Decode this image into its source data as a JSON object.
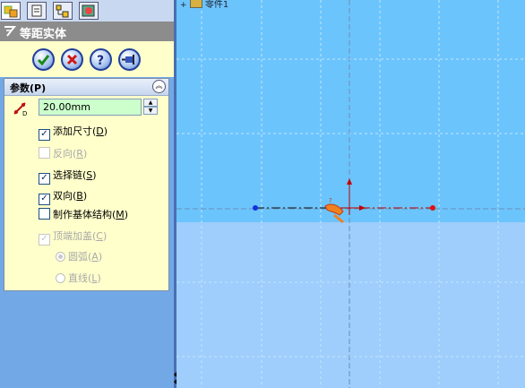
{
  "tree": {
    "item_label": "零件1"
  },
  "panel": {
    "title": "等距实体",
    "group_title": "参数(P)",
    "dimension": {
      "value": "20.00mm"
    },
    "options": [
      {
        "label": "添加尺寸(D)",
        "checked": true,
        "enabled": true
      },
      {
        "label": "反向(R)",
        "checked": false,
        "enabled": false
      },
      {
        "label": "选择链(S)",
        "checked": true,
        "enabled": true
      },
      {
        "label": "双向(B)",
        "checked": true,
        "enabled": true
      },
      {
        "label": "制作基体结构(M)",
        "checked": false,
        "enabled": true
      },
      {
        "label": "顶端加盖(C)",
        "checked": true,
        "enabled": false
      }
    ],
    "cap_options": [
      {
        "label": "圆弧(A)",
        "selected": true
      },
      {
        "label": "直线(L)",
        "selected": false
      }
    ]
  },
  "colors": {
    "background": "#6cc4fc",
    "lower": "#9fcdfc",
    "panel": "#ffffcc",
    "sketch_line": "#c00000",
    "point": "#1030e0"
  }
}
